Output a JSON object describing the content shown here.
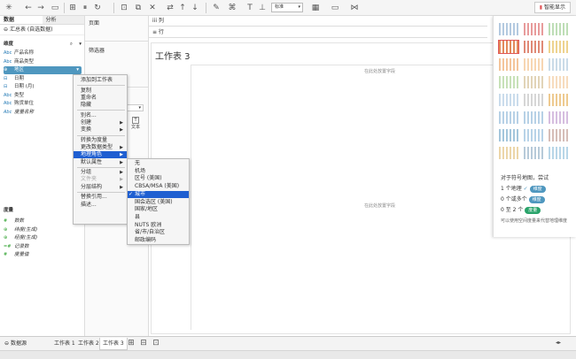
{
  "toolbar": {
    "icons": [
      "tableau-logo-icon",
      "back-icon",
      "forward-icon",
      "save-icon",
      "new-datasource-icon",
      "pause-icon",
      "refresh-icon",
      "new-sheet-icon",
      "duplicate-icon",
      "clear-icon",
      "swap-icon",
      "sort-asc-icon",
      "sort-desc-icon",
      "highlight-icon",
      "group-icon",
      "label-icon",
      "fix-axes-icon",
      "fit-select",
      "presentation-icon",
      "share-icon"
    ],
    "fit_value": "标准",
    "smart_label": "智能显示"
  },
  "left": {
    "tab_data": "数据",
    "tab_analysis": "分析",
    "datasource": "汇总表 (自选数据)",
    "dimensions_header": "维度",
    "dimensions": [
      {
        "type": "Abc",
        "name": "产品名称"
      },
      {
        "type": "Abc",
        "name": "商品类型"
      },
      {
        "type": "⊕",
        "name": "地区"
      },
      {
        "type": "⊟",
        "name": "日期"
      },
      {
        "type": "⊟",
        "name": "日期 (月)"
      },
      {
        "type": "Abc",
        "name": "类型"
      },
      {
        "type": "Abc",
        "name": "购货单位"
      },
      {
        "type": "Abc",
        "name": "度量名称"
      }
    ],
    "measures_header": "度量",
    "measures": [
      {
        "type": "#",
        "name": "数数"
      },
      {
        "type": "⊕",
        "name": "纬度(生成)"
      },
      {
        "type": "⊕",
        "name": "经度(生成)"
      },
      {
        "type": "=#",
        "name": "记录数"
      },
      {
        "type": "#",
        "name": "度量值"
      }
    ]
  },
  "mid": {
    "pages": "页面",
    "filters": "筛选器",
    "marks_text": "文本"
  },
  "shelves": {
    "columns": "iii 列",
    "rows": "≡ 行"
  },
  "view": {
    "title": "工作表 3",
    "drop_top": "在此处放置字段",
    "drop_center": "在此处放置字段"
  },
  "context_menu": [
    {
      "label": "添加到工作表",
      "sep_after": true
    },
    {
      "label": "复制"
    },
    {
      "label": "重命名"
    },
    {
      "label": "隐藏",
      "sep_after": true
    },
    {
      "label": "别名..."
    },
    {
      "label": "创建",
      "sub": true
    },
    {
      "label": "变换",
      "sub": true,
      "sep_after": true
    },
    {
      "label": "转换为度量"
    },
    {
      "label": "更改数据类型",
      "sub": true
    },
    {
      "label": "地理角色",
      "sub": true,
      "highlight": true
    },
    {
      "label": "默认属性",
      "sub": true,
      "sep_after": true
    },
    {
      "label": "分组",
      "sub": true
    },
    {
      "label": "文件夹",
      "sub": true,
      "disabled": true
    },
    {
      "label": "分层结构",
      "sub": true,
      "sep_after": true
    },
    {
      "label": "替换引用..."
    },
    {
      "label": "描述..."
    }
  ],
  "geo_menu": [
    {
      "label": "无"
    },
    {
      "label": "机场"
    },
    {
      "label": "区号 (美国)"
    },
    {
      "label": "CBSA/MSA (美国)"
    },
    {
      "label": "城市",
      "checked": true,
      "highlight": true
    },
    {
      "label": "国会选区 (美国)"
    },
    {
      "label": "国家/地区"
    },
    {
      "label": "县"
    },
    {
      "label": "NUTS 欧洲"
    },
    {
      "label": "省/市/自治区"
    },
    {
      "label": "邮政编码"
    }
  ],
  "showme": {
    "hint_title": "对于符号地图，尝试",
    "req1_prefix": "1 个地理",
    "req1_pill": "维度",
    "req2_prefix": "0 个或多个",
    "req2_pill": "维度",
    "req3_prefix": "0 至 2 个",
    "req3_pill": "度量",
    "note": "可以使用空间度量来代替地理维度"
  },
  "bottom": {
    "datasource_tab": "数据源",
    "sheets": [
      "工作表 1",
      "工作表 2",
      "工作表 3"
    ],
    "active_sheet_index": 2
  }
}
